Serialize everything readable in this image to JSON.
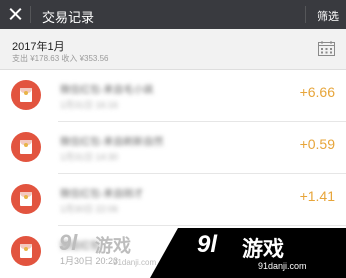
{
  "topbar": {
    "title": "交易记录",
    "filter_label": "筛选",
    "close_icon": "close-icon",
    "background": "#393a3f"
  },
  "month_header": {
    "month": "2017年1月",
    "summary": "支出 ¥178.63 收入 ¥353.56",
    "calendar_icon": "calendar-icon"
  },
  "transactions": [
    {
      "name": "微信红包-来自毛小飒",
      "date": "1月31日 16:16",
      "amount": "+6.66",
      "icon": "red-packet-icon"
    },
    {
      "name": "微信红包-来自刷新自然",
      "date": "1月31日 14:30",
      "amount": "+0.59",
      "icon": "red-packet-icon"
    },
    {
      "name": "微信红包-来自刚才",
      "date": "1月30日 22:06",
      "amount": "+1.41",
      "icon": "red-packet-icon"
    },
    {
      "name": "微信红包",
      "date": "1月30日 20:23",
      "amount": "",
      "icon": "red-packet-icon"
    }
  ],
  "watermark": {
    "left_logo_num": "9l",
    "left_logo_text": "游戏",
    "left_url": "91danji.com",
    "right_logo_num": "9l",
    "right_logo_text": "游戏",
    "right_url": "91danji.com"
  },
  "colors": {
    "amount": "#e7a53a",
    "avatar": "#e2543f"
  }
}
